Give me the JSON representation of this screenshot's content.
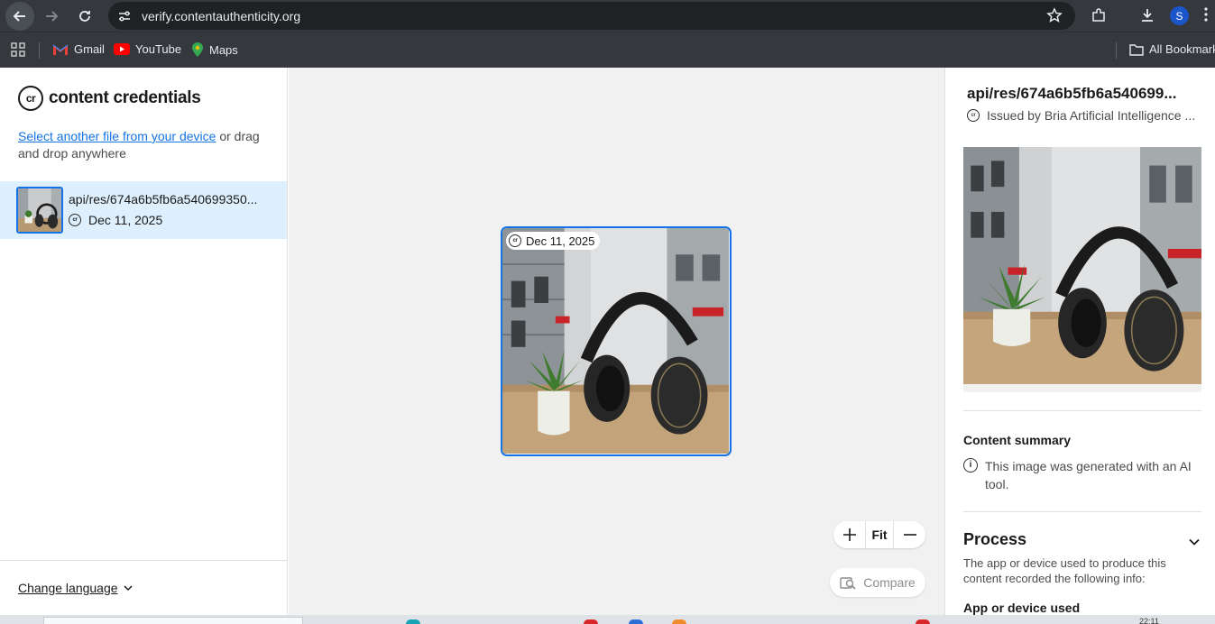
{
  "browser": {
    "url": "verify.contentauthenticity.org",
    "profile_initial": "S",
    "bookmarks": [
      "Gmail",
      "YouTube",
      "Maps"
    ],
    "all_bookmarks_label": "All Bookmarks"
  },
  "left_panel": {
    "logo_mark": "cr",
    "logo_text": "content credentials",
    "select_link": "Select another file from your device",
    "select_rest": " or drag and drop anywhere",
    "file": {
      "name": "api/res/674a6b5fb6a540699350...",
      "date": "Dec 11, 2025"
    },
    "change_language": "Change language"
  },
  "canvas": {
    "image_date": "Dec 11, 2025",
    "zoom_in": "+",
    "fit_label": "Fit",
    "zoom_out": "—",
    "compare_label": "Compare"
  },
  "right_panel": {
    "title": "api/res/674a6b5fb6a540699...",
    "issuer": "Issued by Bria Artificial Intelligence ...",
    "content_summary_title": "Content summary",
    "content_summary_text": "This image was generated with an AI tool.",
    "process_title": "Process",
    "process_desc": "The app or device used to produce this content recorded the following info:",
    "app_used_label": "App or device used"
  },
  "taskbar": {
    "time": "22:11"
  },
  "colors": {
    "accent": "#1473e6",
    "selected_row": "#deeffd",
    "browser_chrome": "#35393e"
  }
}
